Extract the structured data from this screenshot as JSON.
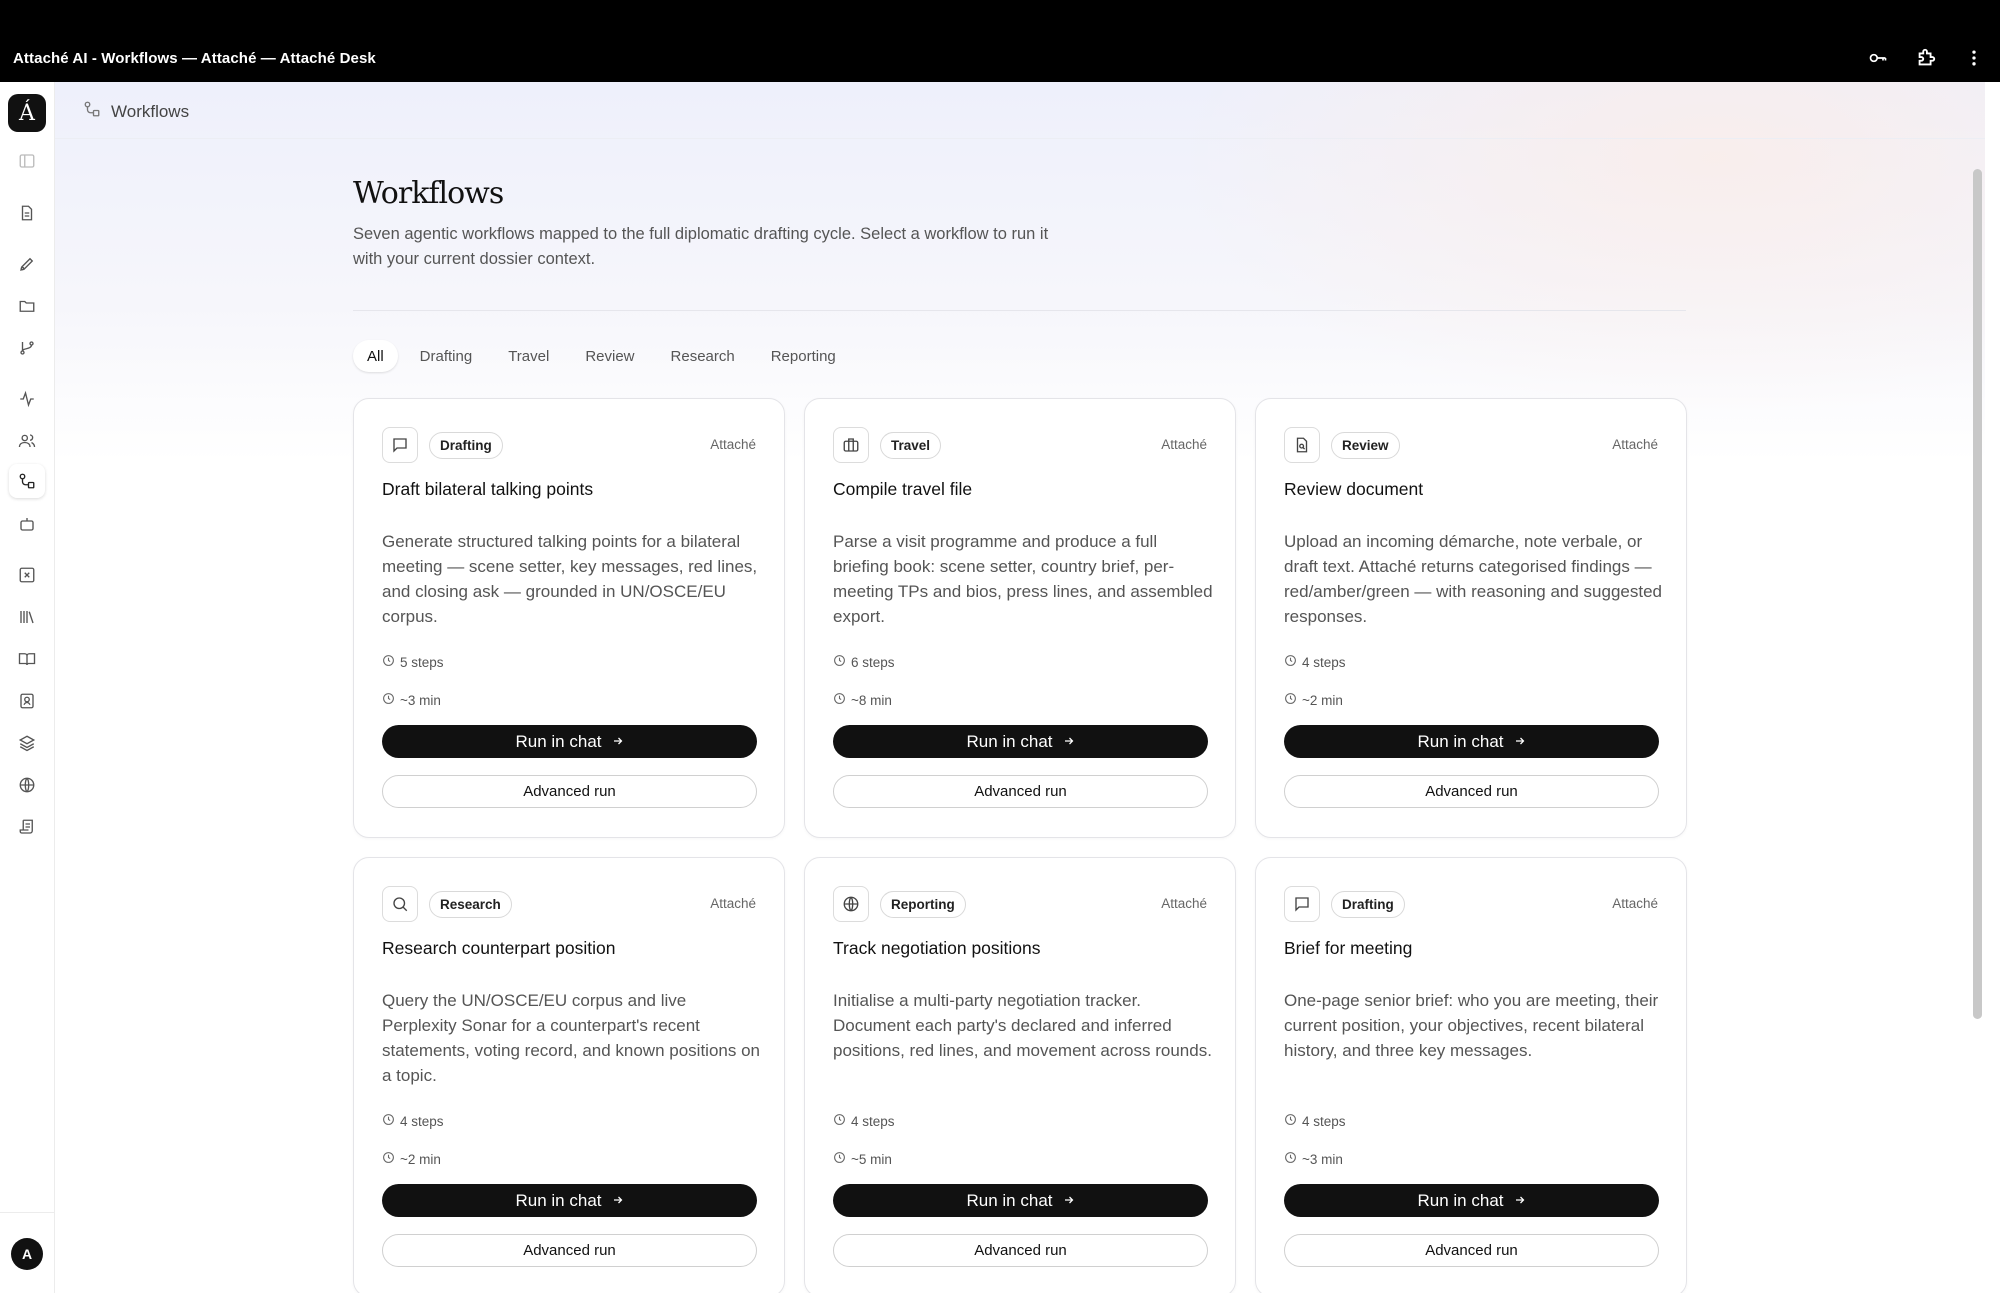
{
  "window": {
    "title": "Attaché AI - Workflows — Attaché — Attaché Desk"
  },
  "sidebar": {
    "logo_letter": "Á",
    "avatar_letter": "A",
    "items": [
      {
        "icon": "sidebar-toggle-icon"
      },
      {
        "icon": "document-icon"
      },
      {
        "icon": "pen-icon"
      },
      {
        "icon": "folder-icon"
      },
      {
        "icon": "branch-icon"
      },
      {
        "icon": "activity-icon"
      },
      {
        "icon": "users-icon"
      },
      {
        "icon": "workflow-icon",
        "active": true
      },
      {
        "icon": "bot-icon"
      },
      {
        "icon": "x-square-icon"
      },
      {
        "icon": "library-icon"
      },
      {
        "icon": "book-open-icon"
      },
      {
        "icon": "contact-book-icon"
      },
      {
        "icon": "layers-icon"
      },
      {
        "icon": "globe-icon"
      },
      {
        "icon": "scroll-icon"
      }
    ]
  },
  "breadcrumb": {
    "label": "Workflows"
  },
  "header": {
    "title": "Workflows",
    "subtitle": "Seven agentic workflows mapped to the full diplomatic drafting cycle. Select a workflow to run it with your current dossier context."
  },
  "filters": [
    "All",
    "Drafting",
    "Travel",
    "Review",
    "Research",
    "Reporting"
  ],
  "active_filter": "All",
  "run_label": "Run in chat",
  "advanced_label": "Advanced run",
  "cards": [
    {
      "icon": "chat-icon",
      "tag": "Drafting",
      "owner": "Attaché",
      "title": "Draft bilateral talking points",
      "description": "Generate structured talking points for a bilateral meeting — scene setter, key messages, red lines, and closing ask — grounded in UN/OSCE/EU corpus.",
      "steps": "5 steps",
      "time": "~3 min"
    },
    {
      "icon": "briefcase-icon",
      "tag": "Travel",
      "owner": "Attaché",
      "title": "Compile travel file",
      "description": "Parse a visit programme and produce a full briefing book: scene setter, country brief, per-meeting TPs and bios, press lines, and assembled export.",
      "steps": "6 steps",
      "time": "~8 min"
    },
    {
      "icon": "file-search-icon",
      "tag": "Review",
      "owner": "Attaché",
      "title": "Review document",
      "description": "Upload an incoming démarche, note verbale, or draft text. Attaché returns categorised findings — red/amber/green — with reasoning and suggested responses.",
      "steps": "4 steps",
      "time": "~2 min"
    },
    {
      "icon": "search-icon",
      "tag": "Research",
      "owner": "Attaché",
      "title": "Research counterpart position",
      "description": "Query the UN/OSCE/EU corpus and live Perplexity Sonar for a counterpart's recent statements, voting record, and known positions on a topic.",
      "steps": "4 steps",
      "time": "~2 min"
    },
    {
      "icon": "globe-icon",
      "tag": "Reporting",
      "owner": "Attaché",
      "title": "Track negotiation positions",
      "description": "Initialise a multi-party negotiation tracker. Document each party's declared and inferred positions, red lines, and movement across rounds.",
      "steps": "4 steps",
      "time": "~5 min"
    },
    {
      "icon": "chat-icon",
      "tag": "Drafting",
      "owner": "Attaché",
      "title": "Brief for meeting",
      "description": "One-page senior brief: who you are meeting, their current position, your objectives, recent bilateral history, and three key messages.",
      "steps": "4 steps",
      "time": "~3 min"
    }
  ]
}
